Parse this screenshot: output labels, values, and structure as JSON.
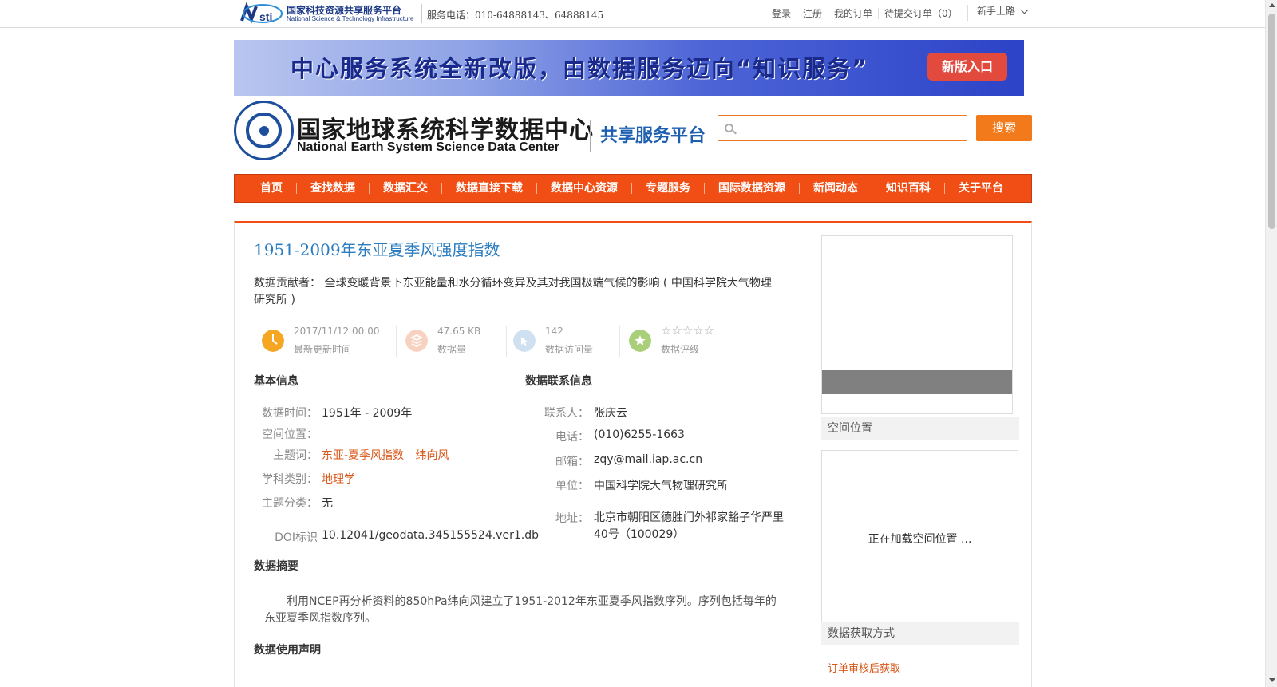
{
  "topbar": {
    "logo_cn": "国家科技资源共享服务平台",
    "logo_en": "National Science & Technology Infrastructure",
    "service_tel": "服务电话：010-64888143、64888145",
    "links": [
      "登录",
      "注册",
      "我的订单",
      "待提交订单（0）"
    ],
    "newbie": "新手上路"
  },
  "banner": {
    "text": "中心服务系统全新改版，由数据服务迈向“知识服务”",
    "button": "新版入口"
  },
  "site": {
    "name_cn": "国家地球系统科学数据中心",
    "name_en": "National Earth System Science Data Center",
    "subtitle": "共享服务平台"
  },
  "search": {
    "placeholder": "",
    "button": "搜索"
  },
  "nav": [
    "首页",
    "查找数据",
    "数据汇交",
    "数据直接下载",
    "数据中心资源",
    "专题服务",
    "国际数据资源",
    "新闻动态",
    "知识百科",
    "关于平台"
  ],
  "dataset": {
    "title": "1951-2009年东亚夏季风强度指数",
    "contributor_label": "数据贡献者：",
    "contributor_value": "全球变暖背景下东亚能量和水分循环变异及其对我国极端气候的影响 ( 中国科学院大气物理研究所 )"
  },
  "stats": {
    "updated_value": "2017/11/12 00:00",
    "updated_label": "最新更新时间",
    "size_value": "47.65 KB",
    "size_label": "数据量",
    "visits_value": "142",
    "visits_label": "数据访问量",
    "rating_stars": "☆☆☆☆☆",
    "rating_label": "数据评级",
    "colors": {
      "clock": "#f5a623",
      "size": "#f7d2c0",
      "visits": "#cfe0f0",
      "rating": "#a9cf7a"
    }
  },
  "basic_info": {
    "title": "基本信息",
    "time_label": "数据时间：",
    "time_value": "1951年 - 2009年",
    "space_label": "空间位置：",
    "keyword_label": "主题词：",
    "keywords": [
      "东亚-夏季风指数",
      "纬向风"
    ],
    "discipline_label": "学科类别：",
    "discipline_value": "地理学",
    "category_label": "主题分类：",
    "category_value": "无",
    "doi_label": "DOI标识",
    "doi_value": "10.12041/geodata.345155524.ver1.db"
  },
  "contact_info": {
    "title": "数据联系信息",
    "person_label": "联系人：",
    "person_value": "张庆云",
    "phone_label": "电话：",
    "phone_value": "(010)6255-1663",
    "email_label": "邮箱：",
    "email_value": "zqy@mail.iap.ac.cn",
    "unit_label": "单位：",
    "unit_value": "中国科学院大气物理研究所",
    "address_label": "地址：",
    "address_value": "北京市朝阳区德胜门外祁家豁子华严里40号（100029）"
  },
  "abstract": {
    "title": "数据摘要",
    "text": "利用NCEP再分析资料的850hPa纬向风建立了1951-2012年东亚夏季风指数序列。序列包括每年的东亚夏季风指数序列。"
  },
  "usage": {
    "title": "数据使用声明"
  },
  "sidebar": {
    "space_title": "空间位置",
    "map_loading": "正在加载空间位置 ...",
    "access_title": "数据获取方式",
    "access_link": "订单审核后获取"
  }
}
